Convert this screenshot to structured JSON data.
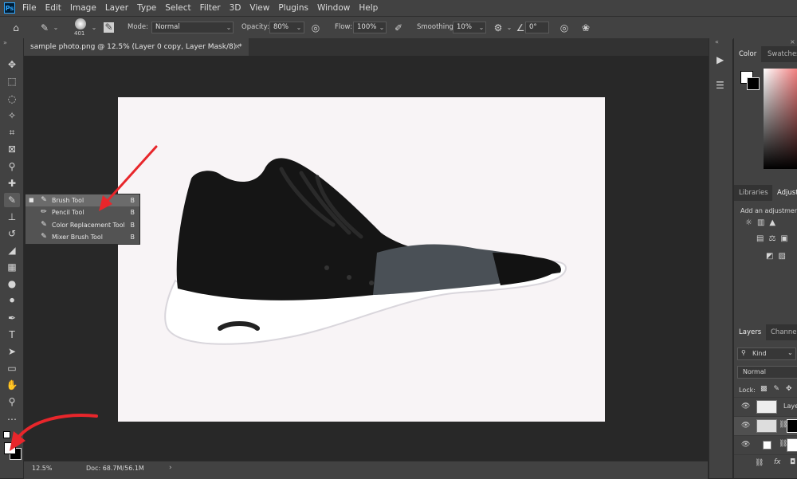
{
  "menubar": {
    "logo": "Ps",
    "items": [
      "File",
      "Edit",
      "Image",
      "Layer",
      "Type",
      "Select",
      "Filter",
      "3D",
      "View",
      "Plugins",
      "Window",
      "Help"
    ]
  },
  "options": {
    "brush_size": "401",
    "mode_label": "Mode:",
    "mode_value": "Normal",
    "opacity_label": "Opacity:",
    "opacity_value": "80%",
    "flow_label": "Flow:",
    "flow_value": "100%",
    "smoothing_label": "Smoothing:",
    "smoothing_value": "10%",
    "angle_value": "0°"
  },
  "document": {
    "tab_title": "sample photo.png @ 12.5% (Layer 0 copy, Layer Mask/8) *",
    "close_glyph": "×"
  },
  "flyout": {
    "items": [
      {
        "label": "Brush Tool",
        "key": "B",
        "selected": true
      },
      {
        "label": "Pencil Tool",
        "key": "B",
        "selected": false
      },
      {
        "label": "Color Replacement Tool",
        "key": "B",
        "selected": false
      },
      {
        "label": "Mixer Brush Tool",
        "key": "B",
        "selected": false
      }
    ]
  },
  "status": {
    "zoom": "12.5%",
    "doc": "Doc: 68.7M/56.1M"
  },
  "panels": {
    "color_tabs": [
      "Color",
      "Swatches"
    ],
    "lib_tabs": [
      "Libraries",
      "Adjust"
    ],
    "adjust_hint": "Add an adjustment",
    "layers_tabs": [
      "Layers",
      "Channels"
    ],
    "kind_filter": "Kind",
    "blend_mode": "Normal",
    "lock_label": "Lock:",
    "layer_names": [
      "Layer",
      "",
      ""
    ]
  },
  "colors": {
    "accent_arrow": "#e8262b",
    "canvas_bg": "#f8f4f6",
    "workspace": "#282828",
    "panel": "#424242"
  }
}
